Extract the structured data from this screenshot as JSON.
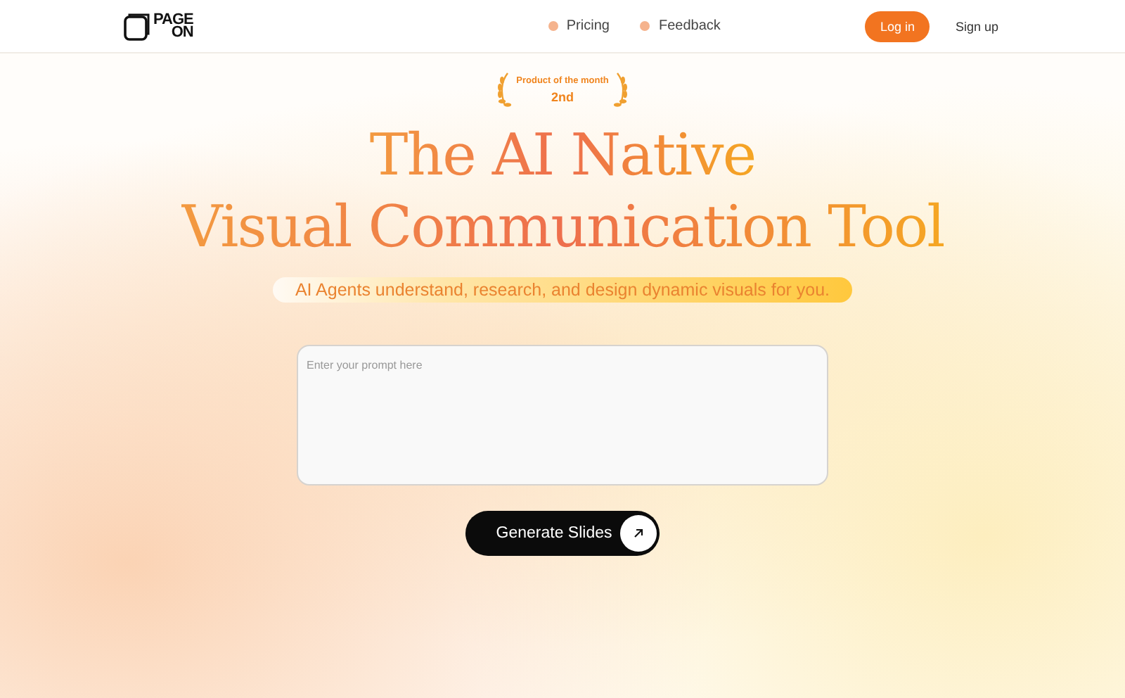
{
  "logo": {
    "top": "PAGE",
    "bottom": "ON"
  },
  "nav": [
    {
      "label": "Pricing"
    },
    {
      "label": "Feedback"
    }
  ],
  "auth": {
    "login": "Log in",
    "signup": "Sign up"
  },
  "award": {
    "title": "Product of the month",
    "rank": "2nd"
  },
  "headline": [
    "The AI Native",
    "Visual Communication Tool"
  ],
  "tagline": "AI Agents understand, research, and design dynamic visuals for you.",
  "prompt": {
    "placeholder": "Enter your prompt here"
  },
  "cta": "Generate Slides"
}
